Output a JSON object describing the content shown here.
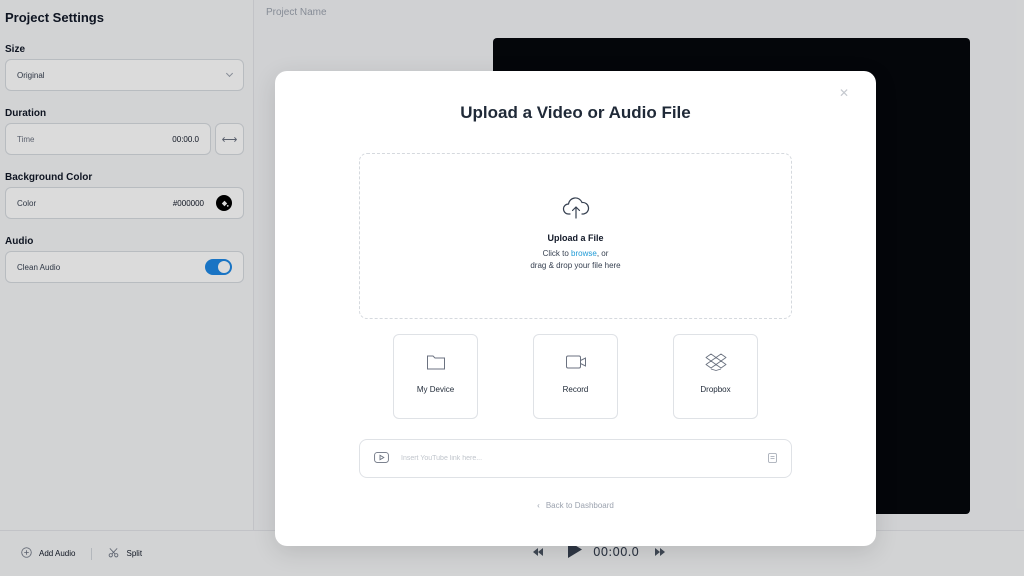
{
  "sidebar": {
    "title": "Project Settings",
    "size": {
      "label": "Size",
      "value": "Original"
    },
    "duration": {
      "label": "Duration",
      "field_label": "Time",
      "value": "00:00.0"
    },
    "background": {
      "label": "Background Color",
      "field_label": "Color",
      "value": "#000000"
    },
    "audio": {
      "label": "Audio",
      "clean_label": "Clean Audio",
      "clean_enabled": true
    }
  },
  "header": {
    "project_name": "Project Name"
  },
  "bottombar": {
    "add_audio": "Add Audio",
    "split": "Split",
    "time": "00:00.0"
  },
  "modal": {
    "title": "Upload a Video or Audio File",
    "dropzone": {
      "title": "Upload a File",
      "click_to": "Click to ",
      "browse": "browse",
      "or": ", or",
      "drag_drop": "drag & drop your file here"
    },
    "sources": [
      {
        "label": "My Device",
        "icon": "folder-icon"
      },
      {
        "label": "Record",
        "icon": "camera-icon"
      },
      {
        "label": "Dropbox",
        "icon": "dropbox-icon"
      }
    ],
    "youtube": {
      "placeholder": "Insert YouTube link here..."
    },
    "back": "Back to Dashboard"
  },
  "colors": {
    "accent": "#1e9ad6",
    "toggle": "#1e88e5",
    "canvas": "#05080c"
  }
}
